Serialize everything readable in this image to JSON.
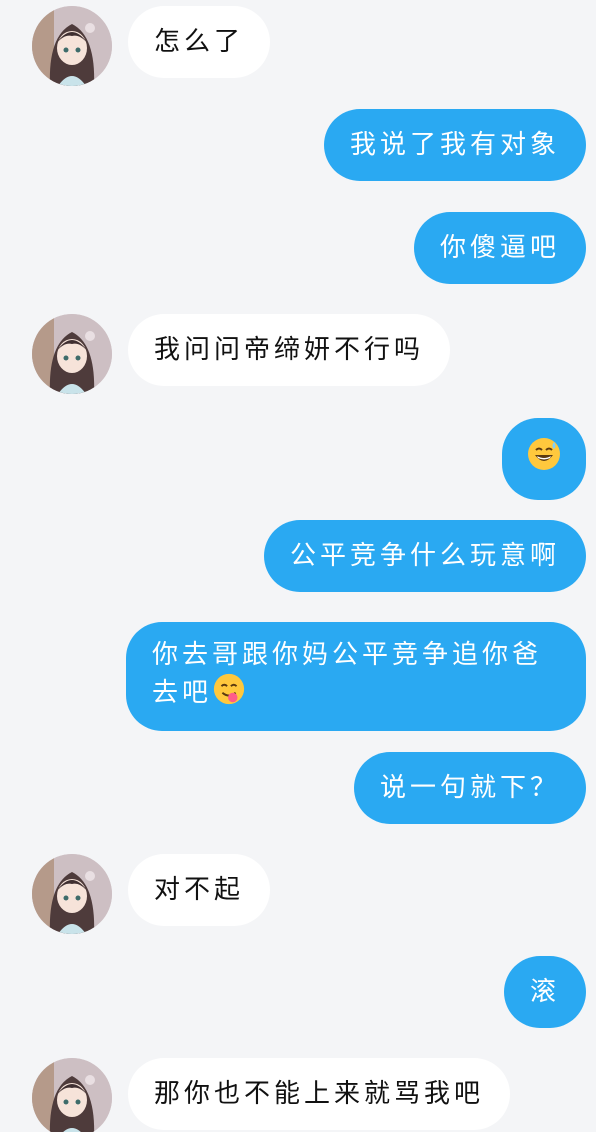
{
  "messages": [
    {
      "side": "in",
      "text": "怎么了"
    },
    {
      "side": "out",
      "text": "我说了我有对象"
    },
    {
      "side": "out",
      "text": "你傻逼吧"
    },
    {
      "side": "in",
      "text": "我问问帝缔妍不行吗"
    },
    {
      "side": "out",
      "text": "",
      "emoji": "grinning-sweat-emoji"
    },
    {
      "side": "out",
      "text": "公平竞争什么玩意啊"
    },
    {
      "side": "out",
      "text": "你去哥跟你妈公平竞争追你爸去吧",
      "emoji": "savoring-food-emoji"
    },
    {
      "side": "out",
      "text": "说一句就下？"
    },
    {
      "side": "in",
      "text": "对不起"
    },
    {
      "side": "out",
      "text": "滚"
    },
    {
      "side": "in",
      "text": "那你也不能上来就骂我吧"
    }
  ],
  "colors": {
    "background": "#f4f5f7",
    "outgoing_bubble": "#2aa9f2",
    "incoming_bubble": "#ffffff"
  }
}
